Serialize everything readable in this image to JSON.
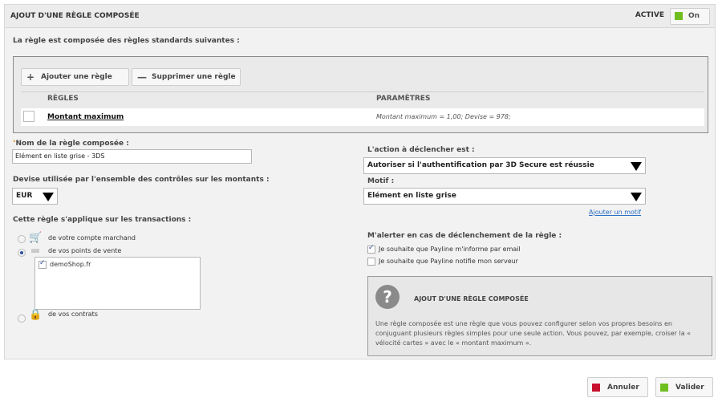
{
  "header": {
    "title": "AJOUT D'UNE RÈGLE COMPOSÉE",
    "active_label": "ACTIVE",
    "toggle_label": "On",
    "toggle_color": "#6fbe1f"
  },
  "intro": "La règle est composée des règles standards suivantes :",
  "rules": {
    "add_label": "Ajouter une règle",
    "remove_label": "Supprimer une règle",
    "col_rules": "RÈGLES",
    "col_params": "PARAMÈTRES",
    "rows": [
      {
        "name": "Montant maximum",
        "params": "Montant maximum = 1,00; Devise = 978;"
      }
    ]
  },
  "name_field": {
    "label": "Nom de la règle composée :",
    "required_mark": "°",
    "value": "Elément en liste grise - 3DS"
  },
  "currency": {
    "label": "Devise utilisée par l'ensemble des contrôles sur les montants :",
    "value": "EUR"
  },
  "scope": {
    "label": "Cette règle s'applique sur les transactions :",
    "options": [
      {
        "label": "de votre compte marchand",
        "selected": false
      },
      {
        "label": "de vos points de vente",
        "selected": true
      },
      {
        "label": "de vos contrats",
        "selected": false
      }
    ],
    "shops": [
      {
        "label": "demoShop.fr",
        "checked": true
      }
    ]
  },
  "action": {
    "label": "L'action à déclencher est :",
    "value": "Autoriser si l'authentification par 3D Secure est réussie"
  },
  "motif": {
    "label": "Motif :",
    "value": "Elément en liste grise",
    "add_link": "Ajouter un motif"
  },
  "alert": {
    "label": "M'alerter en cas de déclenchement de la règle :",
    "options": [
      {
        "label": "Je souhaite que Payline m'informe par email",
        "checked": true
      },
      {
        "label": "Je souhaite que Payline notifie mon serveur",
        "checked": false
      }
    ]
  },
  "help": {
    "title": "AJOUT D'UNE RÈGLE COMPOSÉE",
    "text": "Une règle composée est une règle que vous pouvez configurer selon vos propres besoins en conjuguant plusieurs règles simples pour une seule action. Vous pouvez, par exemple, croiser la « vélocité cartes » avec le « montant maximum »."
  },
  "footer": {
    "cancel_label": "Annuler",
    "cancel_color": "#c8102e",
    "submit_label": "Valider",
    "submit_color": "#6fbe1f"
  }
}
